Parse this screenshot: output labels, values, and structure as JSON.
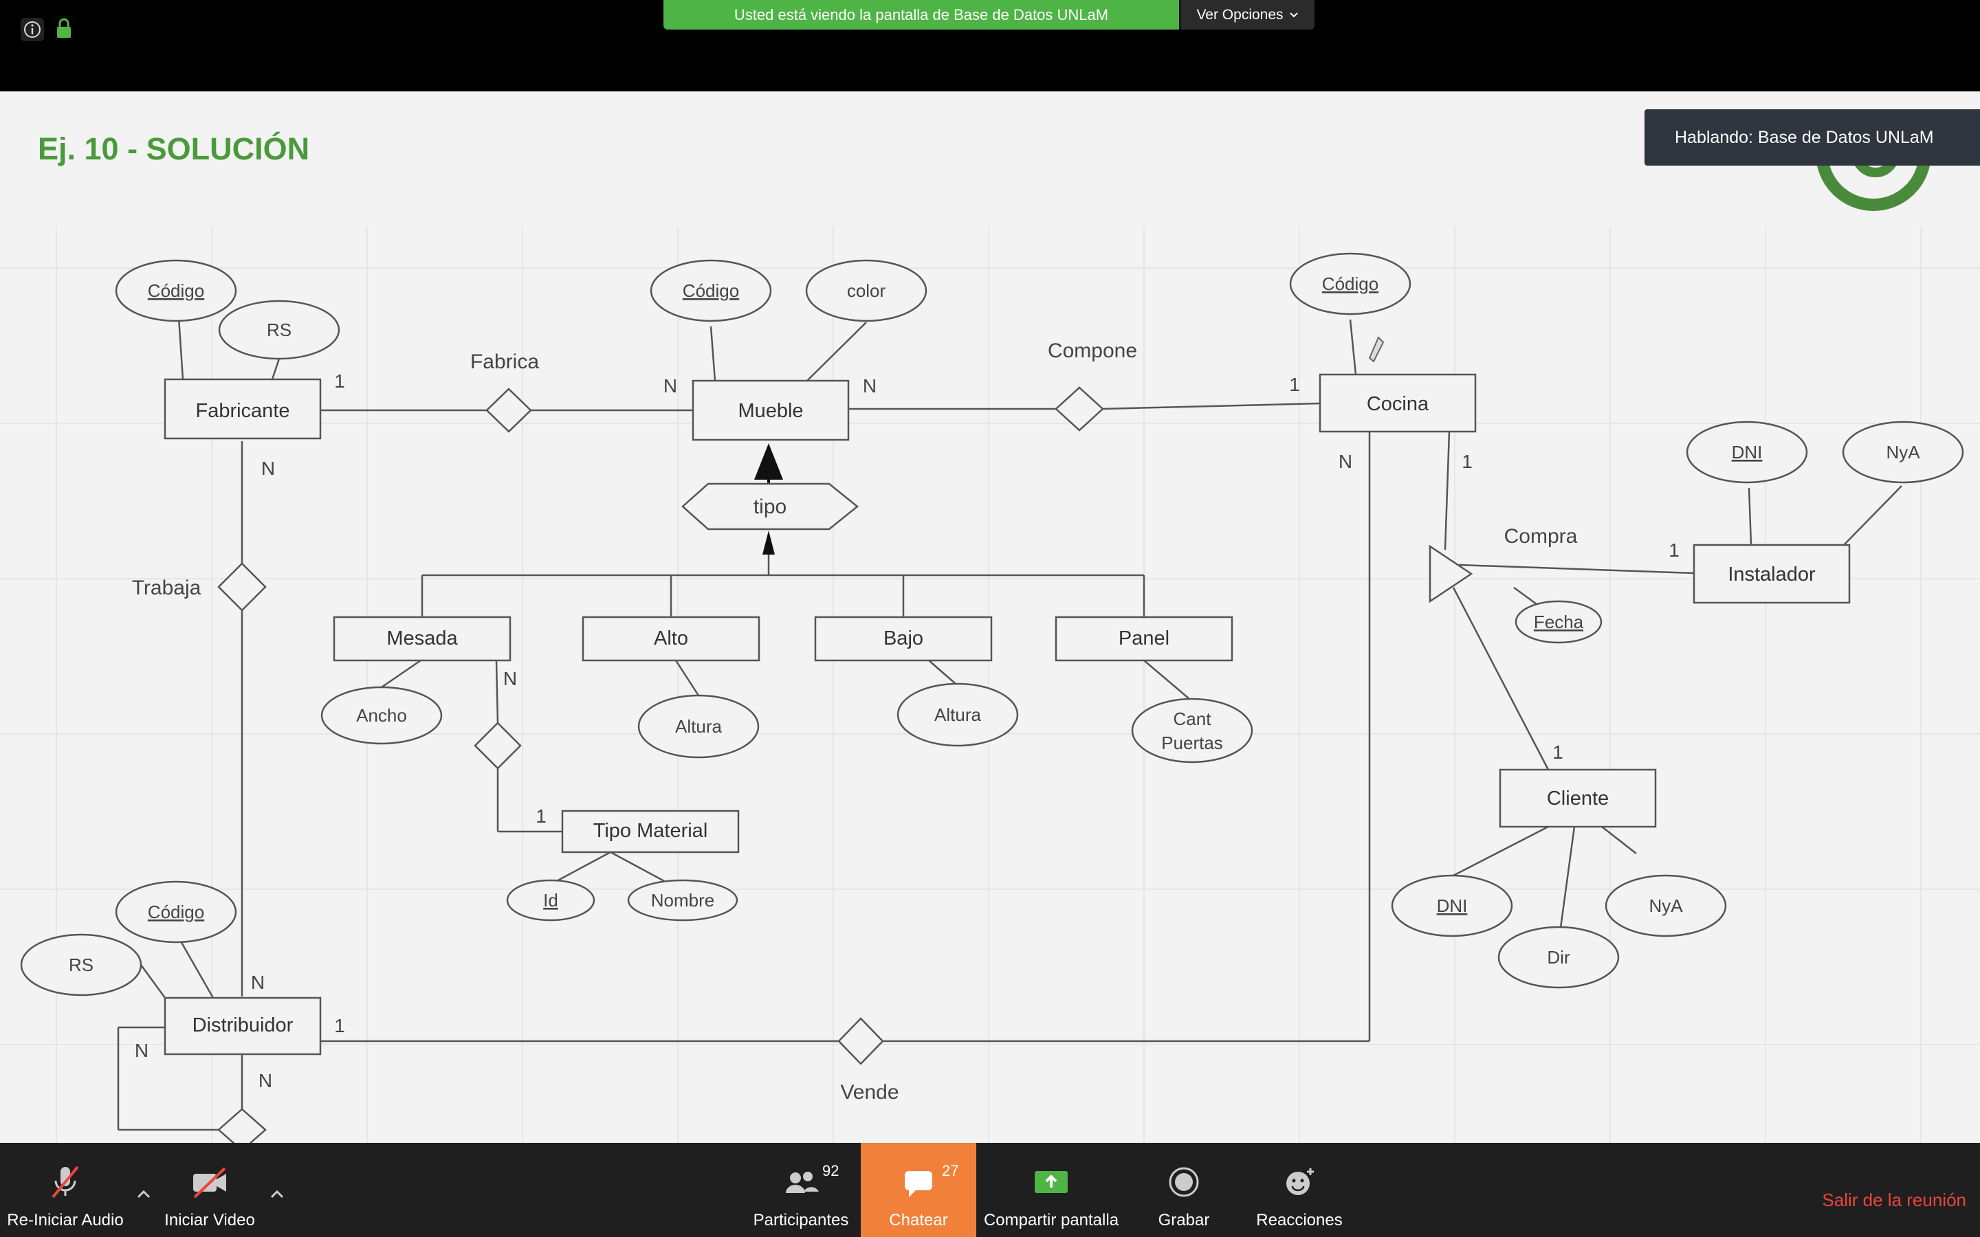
{
  "top_bar": {
    "share_banner": "Usted está viendo la pantalla de Base de Datos UNLaM",
    "view_options": "Ver Opciones"
  },
  "slide": {
    "title": "Ej. 10 - SOLUCIÓN",
    "speaker_tooltip": "Hablando: Base de Datos UNLaM"
  },
  "diagram": {
    "entities": {
      "fabricante": "Fabricante",
      "mueble": "Mueble",
      "cocina": "Cocina",
      "instalador": "Instalador",
      "mesada": "Mesada",
      "alto": "Alto",
      "bajo": "Bajo",
      "panel": "Panel",
      "tipo_material": "Tipo Material",
      "cliente": "Cliente",
      "distribuidor": "Distribuidor"
    },
    "relationships": {
      "fabrica": "Fabrica",
      "compone": "Compone",
      "trabaja": "Trabaja",
      "compra": "Compra",
      "vende": "Vende"
    },
    "specialization": "tipo",
    "attributes": {
      "fab_codigo": "Código",
      "fab_rs": "RS",
      "mueble_codigo": "Código",
      "mueble_color": "color",
      "cocina_codigo": "Código",
      "inst_dni": "DNI",
      "inst_nya": "NyA",
      "compra_fecha": "Fecha",
      "mesada_ancho": "Ancho",
      "alto_altura": "Altura",
      "bajo_altura": "Altura",
      "panel_cant_1": "Cant",
      "panel_cant_2": "Puertas",
      "tm_id": "Id",
      "tm_nombre": "Nombre",
      "cli_dni": "DNI",
      "cli_dir": "Dir",
      "cli_nya": "NyA",
      "dist_codigo": "Código",
      "dist_rs": "RS"
    },
    "cardinalities": {
      "fab_fabrica": "1",
      "mueble_fabrica": "N",
      "mueble_compone": "N",
      "cocina_compone": "1",
      "fab_trabaja": "N",
      "cocina_vende": "N",
      "cocina_compra": "1",
      "inst_compra": "1",
      "mesada_rel": "N",
      "tm_rel": "1",
      "cli_compra": "1",
      "dist_trabaja": "N",
      "dist_vende": "1",
      "dist_self_a": "N",
      "dist_self_b": "N"
    }
  },
  "toolbar": {
    "audio": "Re-Iniciar Audio",
    "video": "Iniciar Video",
    "participants": "Participantes",
    "participants_count": "92",
    "chat": "Chatear",
    "chat_count": "27",
    "share": "Compartir pantalla",
    "record": "Grabar",
    "reactions": "Reacciones",
    "leave": "Salir de la reunión"
  },
  "colors": {
    "banner_green": "#4fb446",
    "title_green": "#4a9a3b",
    "chat_orange": "#f0803a",
    "leave_red": "#e8473d"
  }
}
